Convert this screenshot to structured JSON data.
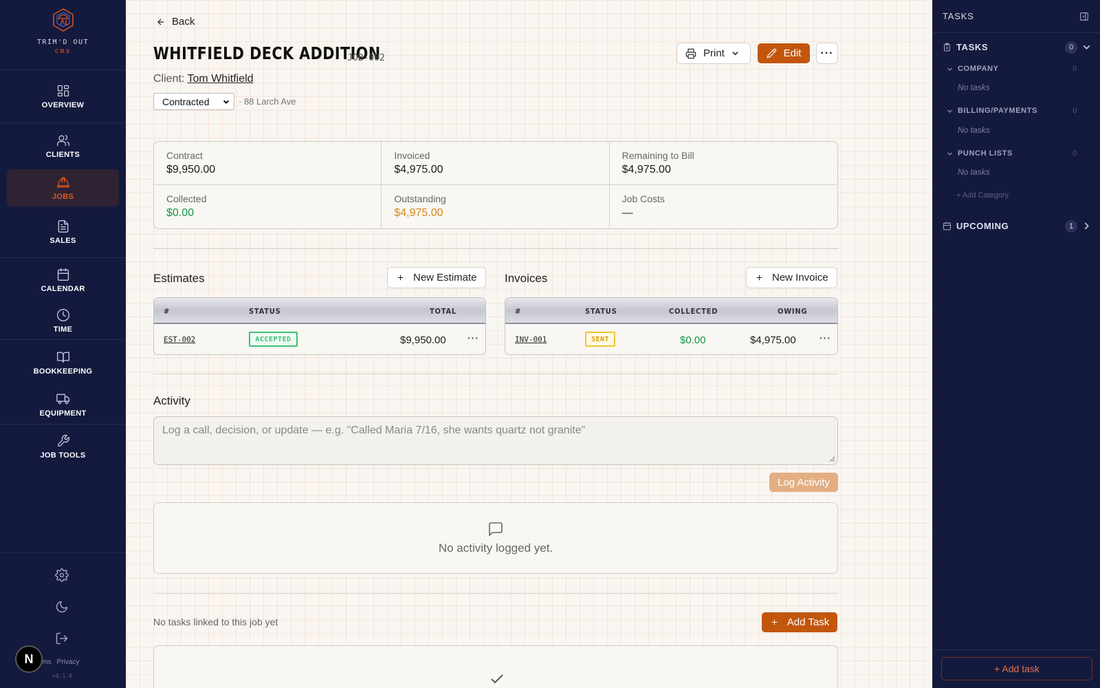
{
  "brand": {
    "name": "TRIM'D OUT",
    "sub": "cms"
  },
  "nav": {
    "items": [
      {
        "label": "OVERVIEW",
        "icon": "grid-icon"
      },
      {
        "label": "CLIENTS",
        "icon": "users-icon"
      },
      {
        "label": "JOBS",
        "icon": "hardhat-icon",
        "active": true
      },
      {
        "label": "SALES",
        "icon": "document-icon"
      },
      {
        "label": "CALENDAR",
        "icon": "calendar-icon"
      },
      {
        "label": "TIME",
        "icon": "clock-icon"
      },
      {
        "label": "BOOKKEEPING",
        "icon": "book-icon"
      },
      {
        "label": "EQUIPMENT",
        "icon": "truck-icon"
      },
      {
        "label": "JOB TOOLS",
        "icon": "wrench-icon"
      }
    ],
    "legal": {
      "terms": "rms",
      "privacy": "Privacy"
    },
    "version": "v0.1.0",
    "badge": "N"
  },
  "header": {
    "back": "Back",
    "title": "WHITFIELD DECK ADDITION",
    "job_code": "JOB-002",
    "client_label": "Client:",
    "client_name": "Tom Whitfield",
    "status": "Contracted",
    "address": "· 88 Larch Ave",
    "print": "Print",
    "edit": "Edit",
    "more": "···"
  },
  "financials": [
    {
      "label": "Contract",
      "value": "$9,950.00"
    },
    {
      "label": "Invoiced",
      "value": "$4,975.00"
    },
    {
      "label": "Remaining to Bill",
      "value": "$4,975.00"
    },
    {
      "label": "Collected",
      "value": "$0.00",
      "tone": "green"
    },
    {
      "label": "Outstanding",
      "value": "$4,975.00",
      "tone": "orange"
    },
    {
      "label": "Job Costs",
      "value": "—"
    }
  ],
  "estimates": {
    "title": "Estimates",
    "new_button": "New Estimate",
    "columns": [
      "#",
      "STATUS",
      "TOTAL"
    ],
    "rows": [
      {
        "number": "EST-002",
        "status": "ACCEPTED",
        "total": "$9,950.00"
      }
    ]
  },
  "invoices": {
    "title": "Invoices",
    "new_button": "New Invoice",
    "columns": [
      "#",
      "STATUS",
      "COLLECTED",
      "OWING"
    ],
    "rows": [
      {
        "number": "INV-001",
        "status": "SENT",
        "collected": "$0.00",
        "owing": "$4,975.00"
      }
    ]
  },
  "activity": {
    "title": "Activity",
    "placeholder": "Log a call, decision, or update — e.g. \"Called Maria 7/16, she wants quartz not granite\"",
    "log_button": "Log Activity",
    "empty": "No activity logged yet."
  },
  "tasks_section": {
    "note": "No tasks linked to this job yet",
    "add_button": "Add Task"
  },
  "right_panel": {
    "header": "TASKS",
    "tasks_title": "TASKS",
    "tasks_count": "0",
    "categories": [
      {
        "name": "COMPANY",
        "count": "0",
        "empty": "No tasks"
      },
      {
        "name": "BILLING/PAYMENTS",
        "count": "0",
        "empty": "No tasks"
      },
      {
        "name": "PUNCH LISTS",
        "count": "0",
        "empty": "No tasks"
      }
    ],
    "add_category": "+ Add Category",
    "upcoming_title": "UPCOMING",
    "upcoming_count": "1",
    "add_task": "+ Add task"
  },
  "colors": {
    "nav_bg": "#141a3d",
    "accent": "#c2560d",
    "active_nav": "#e2561e",
    "green": "#159946",
    "orange": "#d98611"
  }
}
